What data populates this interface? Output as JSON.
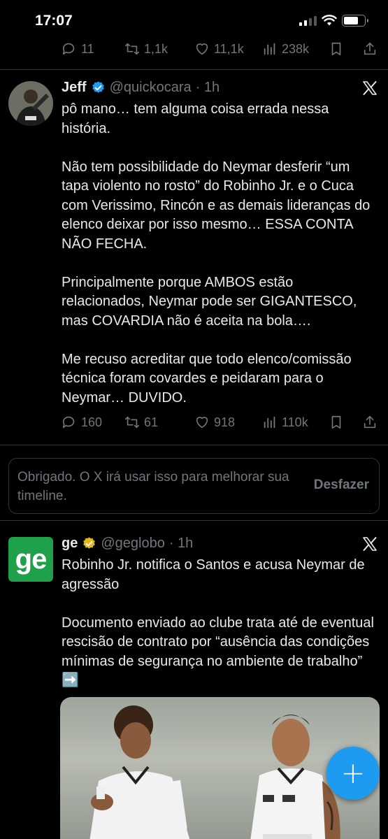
{
  "status_bar": {
    "time": "17:07"
  },
  "top_actions": {
    "replies": "11",
    "reposts": "1,1k",
    "likes": "11,1k",
    "views": "238k"
  },
  "tweet1": {
    "name": "Jeff",
    "handle": "@quickocara",
    "time": "· 1h",
    "text": "pô mano… tem alguma coisa errada nessa história.\n\nNão tem possibilidade do Neymar desferir “um tapa violento no rosto” do Robinho Jr. e o Cuca com Verissimo, Rincón e as demais lideranças do elenco deixar por isso mesmo… ESSA CONTA NÃO FECHA.\n\nPrincipalmente porque AMBOS estão relacionados, Neymar pode ser GIGANTESCO, mas COVARDIA não é aceita na bola….\n\nMe recuso acreditar que todo elenco/comissão técnica foram covardes e peidaram para o Neymar… DUVIDO.",
    "replies": "160",
    "reposts": "61",
    "likes": "918",
    "views": "110k"
  },
  "feedback": {
    "text": "Obrigado. O X irá usar isso para melhorar sua timeline.",
    "undo_label": "Desfazer"
  },
  "tweet2": {
    "logo_text": "ge",
    "name": "ge",
    "handle": "@geglobo",
    "time": "· 1h",
    "text": "Robinho Jr. notifica o Santos e acusa Neymar de agressão\n\nDocumento enviado ao clube trata até de eventual rescisão de contrato por “ausência das condições mínimas de segurança no ambiente de trabalho” ➡️"
  },
  "colors": {
    "accent": "#1d9bf0",
    "verified_blue": "#1d9bf0",
    "verified_gold": "#e2b719",
    "ge_green": "#1fa04a"
  }
}
